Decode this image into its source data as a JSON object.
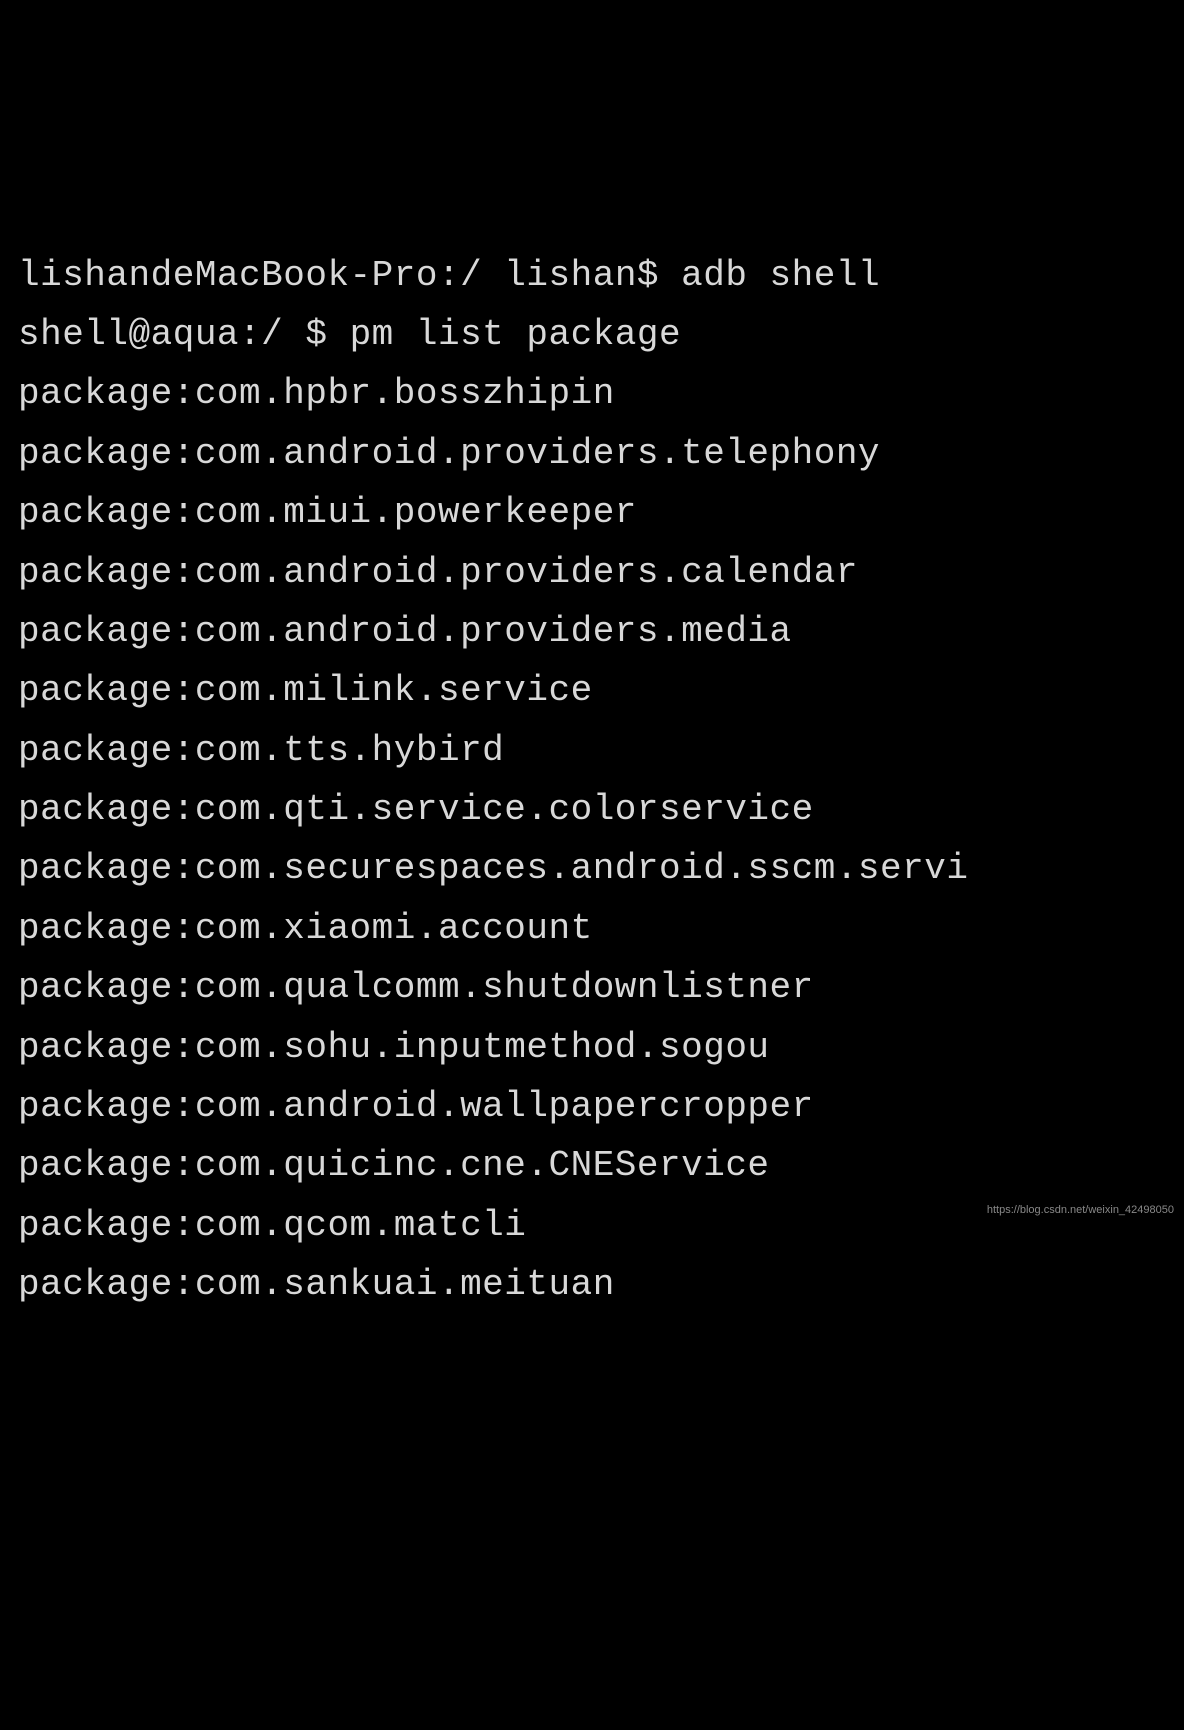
{
  "terminal": {
    "prompt1_host": "lishandeMacBook-Pro:/",
    "prompt1_user": "lishan$",
    "command1": "adb shell",
    "prompt2": "shell@aqua:/ $",
    "command2": "pm list package",
    "packages": [
      "package:com.hpbr.bosszhipin",
      "package:com.android.providers.telephony",
      "package:com.miui.powerkeeper",
      "package:com.android.providers.calendar",
      "package:com.android.providers.media",
      "package:com.milink.service",
      "package:com.tts.hybird",
      "package:com.qti.service.colorservice",
      "package:com.securespaces.android.sscm.servi",
      "package:com.xiaomi.account",
      "package:com.qualcomm.shutdownlistner",
      "package:com.sohu.inputmethod.sogou",
      "package:com.android.wallpapercropper",
      "package:com.quicinc.cne.CNEService",
      "package:com.qcom.matcli",
      "package:com.sankuai.meituan"
    ]
  },
  "watermark": "https://blog.csdn.net/weixin_42498050"
}
